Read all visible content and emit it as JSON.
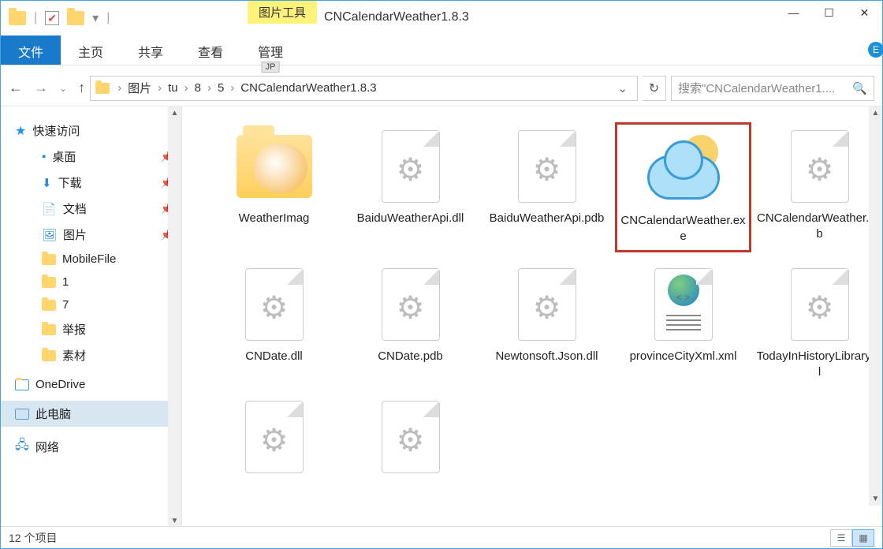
{
  "window": {
    "title": "CNCalendarWeather1.8.3",
    "context_tab": "图片工具",
    "minimize": "—",
    "maximize": "☐",
    "close": "✕"
  },
  "ribbon": {
    "file": "文件",
    "home": "主页",
    "share": "共享",
    "view": "查看",
    "manage": "管理",
    "jp_badge": "JP"
  },
  "breadcrumb": {
    "items": [
      "图片",
      "tu",
      "8",
      "5",
      "CNCalendarWeather1.8.3"
    ]
  },
  "search": {
    "placeholder": "搜索\"CNCalendarWeather1...."
  },
  "sidebar": {
    "quick_access": "快速访问",
    "desktop": "桌面",
    "downloads": "下载",
    "documents": "文档",
    "pictures": "图片",
    "mobilefile": "MobileFile",
    "f1": "1",
    "f7": "7",
    "report": "举报",
    "material": "素材",
    "onedrive": "OneDrive",
    "thispc": "此电脑",
    "network": "网络"
  },
  "files": [
    {
      "name": "WeatherImag",
      "type": "folder"
    },
    {
      "name": "BaiduWeatherApi.dll",
      "type": "dll"
    },
    {
      "name": "BaiduWeatherApi.pdb",
      "type": "pdb"
    },
    {
      "name": "CNCalendarWeather.exe",
      "type": "exe",
      "highlight": true
    },
    {
      "name": "CNCalendarWeather.pdb",
      "type": "pdb"
    },
    {
      "name": "CNDate.dll",
      "type": "dll"
    },
    {
      "name": "CNDate.pdb",
      "type": "pdb"
    },
    {
      "name": "Newtonsoft.Json.dll",
      "type": "dll"
    },
    {
      "name": "provinceCityXml.xml",
      "type": "xml"
    },
    {
      "name": "TodayInHistoryLibrary.dll",
      "type": "dll"
    },
    {
      "name": "",
      "type": "dll"
    },
    {
      "name": "",
      "type": "pdb"
    }
  ],
  "status": {
    "count": "12 个项目"
  }
}
